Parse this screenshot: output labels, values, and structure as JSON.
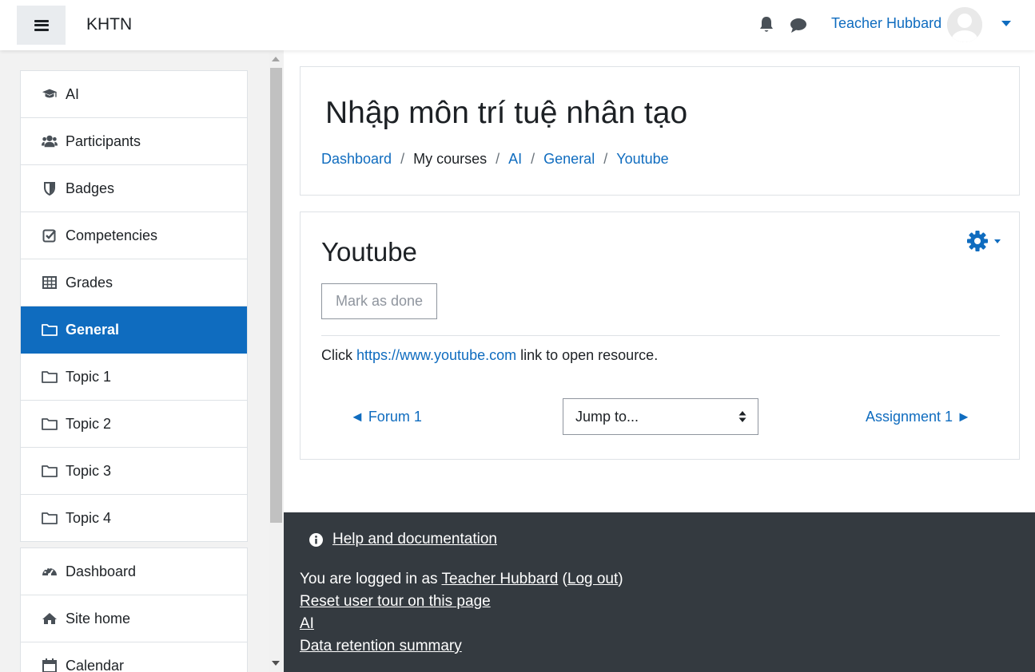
{
  "navbar": {
    "brand": "KHTN",
    "user_name": "Teacher Hubbard"
  },
  "drawer": {
    "course_nav": [
      {
        "label": "AI",
        "icon": "graduation-cap-icon"
      },
      {
        "label": "Participants",
        "icon": "users-icon"
      },
      {
        "label": "Badges",
        "icon": "shield-icon"
      },
      {
        "label": "Competencies",
        "icon": "check-square-icon"
      },
      {
        "label": "Grades",
        "icon": "table-icon"
      },
      {
        "label": "General",
        "icon": "folder-icon",
        "active": true
      },
      {
        "label": "Topic 1",
        "icon": "folder-icon"
      },
      {
        "label": "Topic 2",
        "icon": "folder-icon"
      },
      {
        "label": "Topic 3",
        "icon": "folder-icon"
      },
      {
        "label": "Topic 4",
        "icon": "folder-icon"
      }
    ],
    "site_nav": [
      {
        "label": "Dashboard",
        "icon": "tachometer-icon"
      },
      {
        "label": "Site home",
        "icon": "home-icon"
      },
      {
        "label": "Calendar",
        "icon": "calendar-icon"
      }
    ]
  },
  "header": {
    "title": "Nhập môn trí tuệ nhân tạo",
    "breadcrumb": [
      {
        "label": "Dashboard",
        "link": true
      },
      {
        "label": "My courses",
        "link": false
      },
      {
        "label": "AI",
        "link": true
      },
      {
        "label": "General",
        "link": true
      },
      {
        "label": "Youtube",
        "link": true
      }
    ],
    "separator": "/"
  },
  "activity": {
    "title": "Youtube",
    "mark_done_label": "Mark as done",
    "resource_prefix": "Click ",
    "resource_link": "https://www.youtube.com",
    "resource_suffix": " link to open resource.",
    "prev_label": "◄ Forum 1",
    "next_label": "Assignment 1 ►",
    "jump_label": "Jump to..."
  },
  "footer": {
    "help_label": "Help and documentation",
    "logged_in_prefix": "You are logged in as ",
    "logged_in_user": "Teacher Hubbard",
    "logout_label": "Log out",
    "reset_tour_label": "Reset user tour on this page",
    "course_link": "AI",
    "data_retention_label": "Data retention summary"
  },
  "colors": {
    "accent": "#0f6cbf",
    "footer_bg": "#343a40",
    "drawer_bg": "#f2f2f2"
  }
}
